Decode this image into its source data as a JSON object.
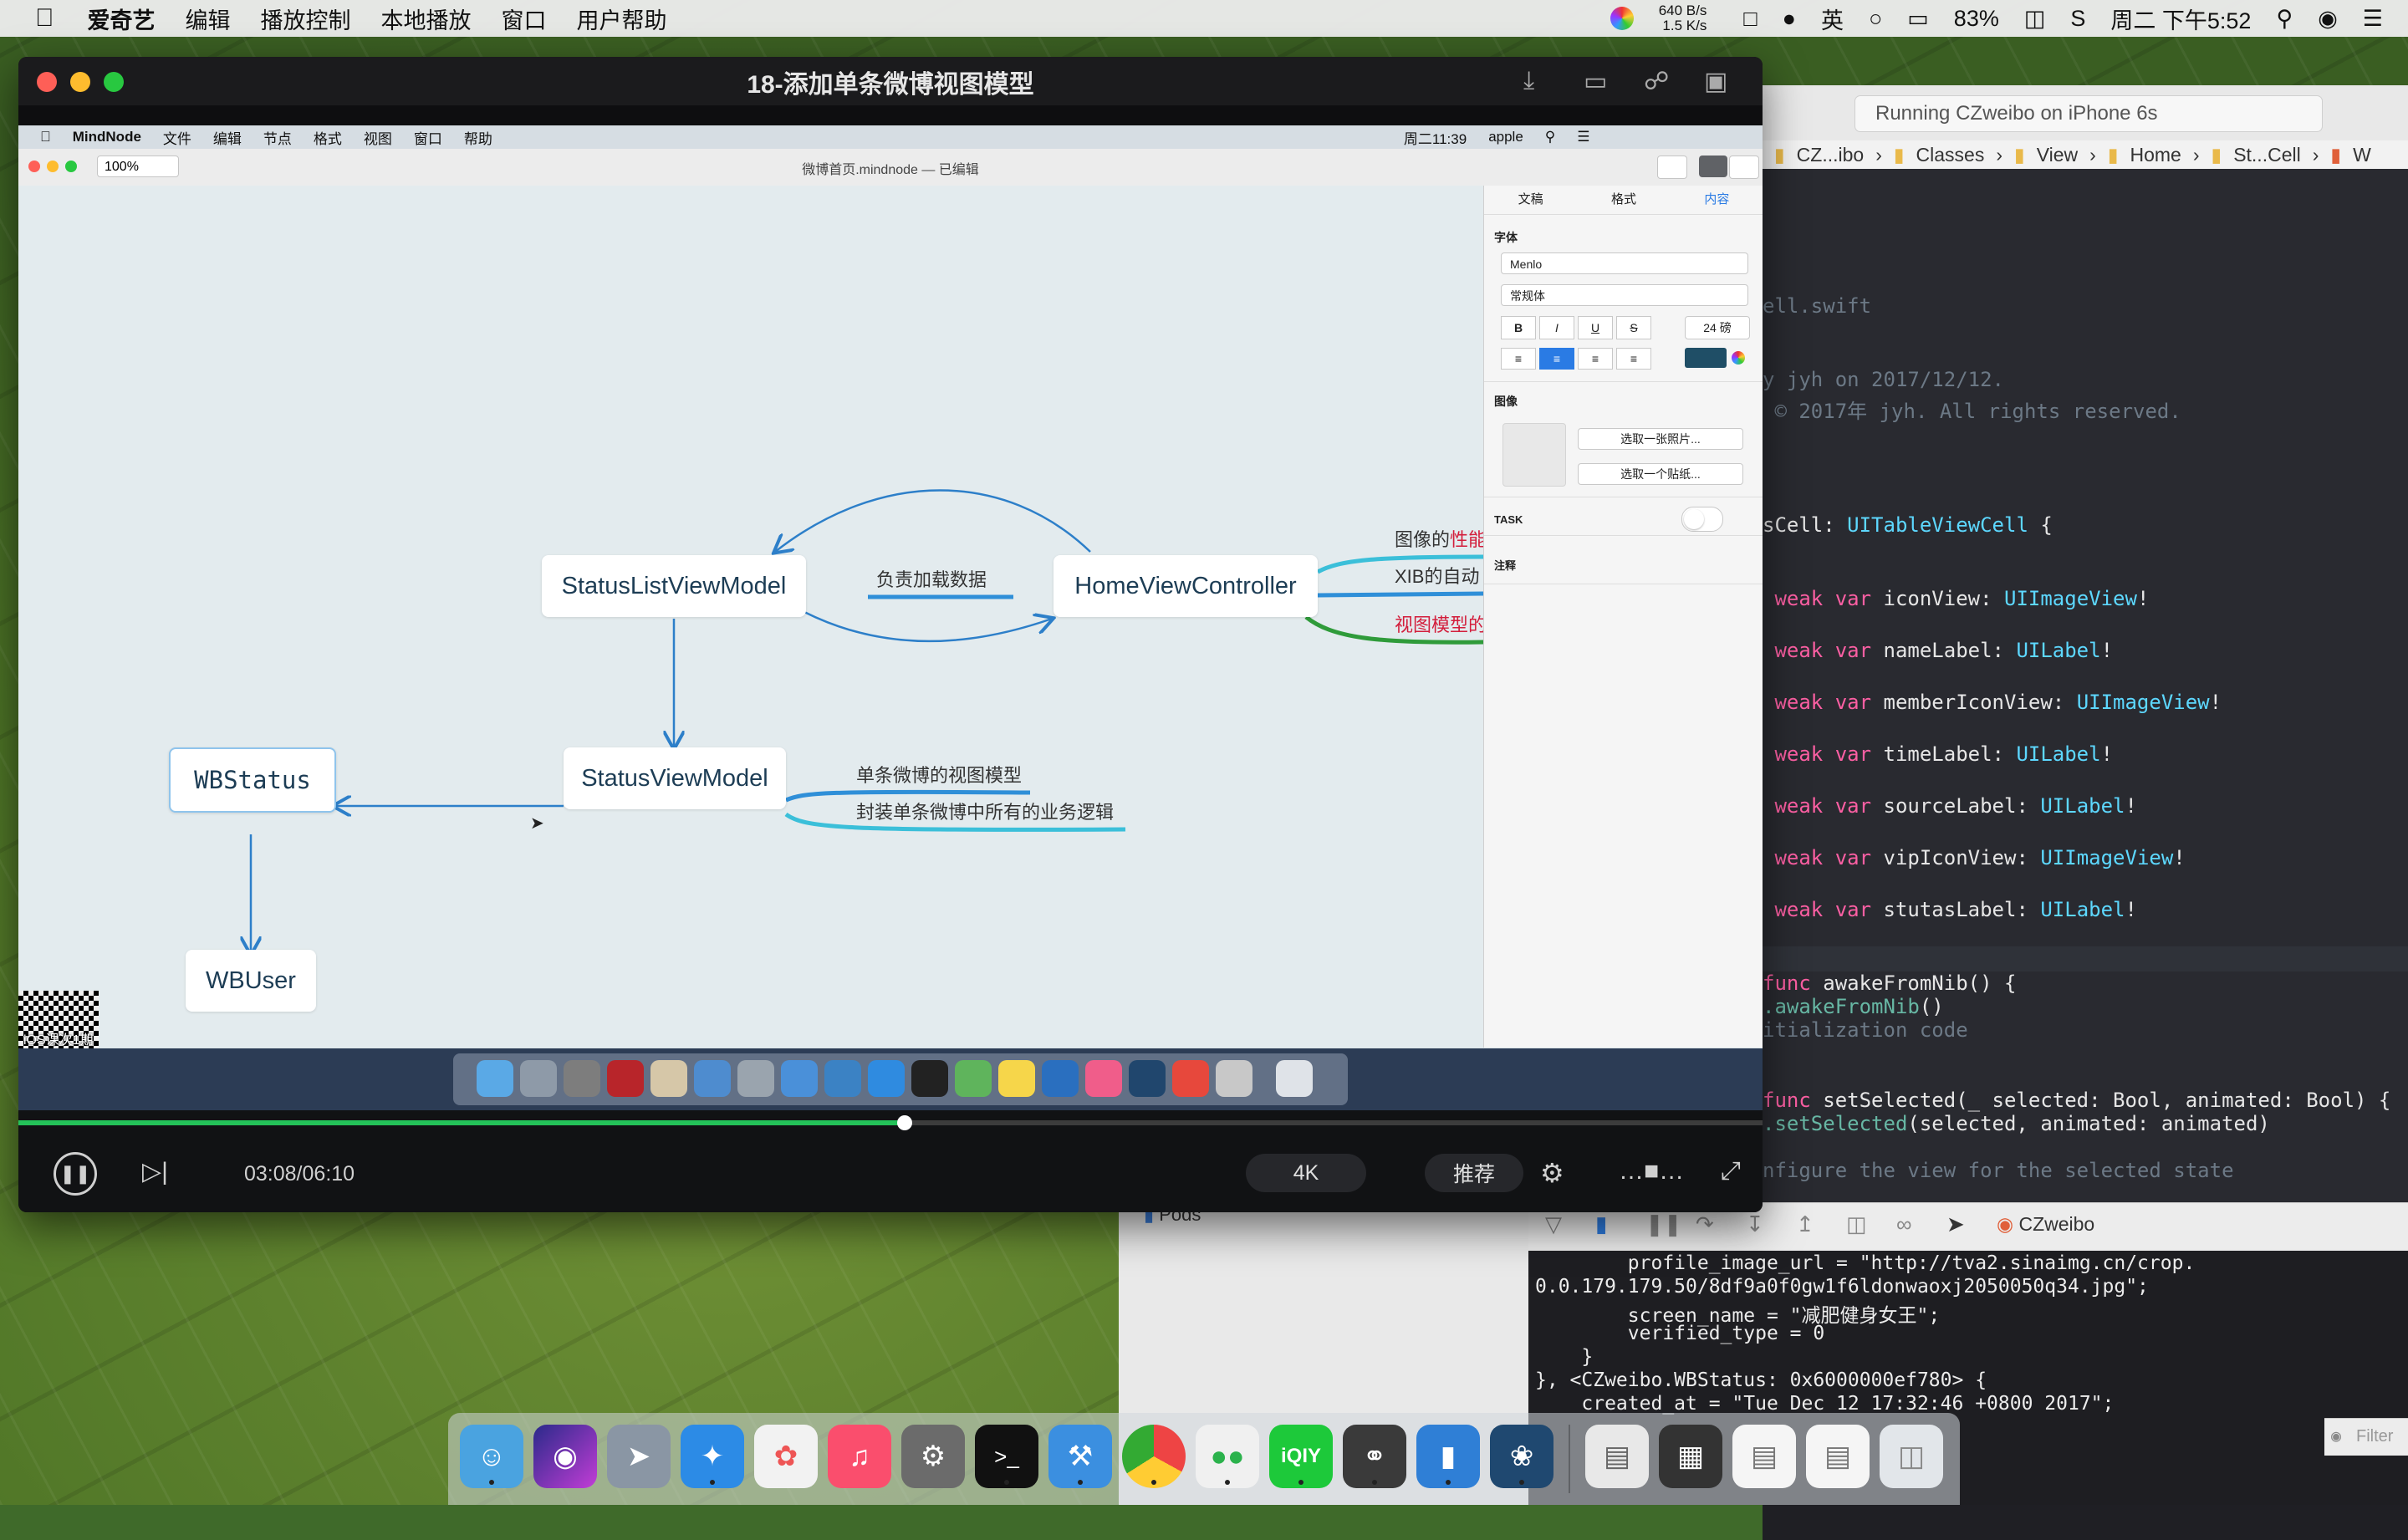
{
  "menubar": {
    "app_name": "爱奇艺",
    "items": [
      "编辑",
      "播放控制",
      "本地播放",
      "窗口",
      "用户帮助"
    ],
    "net_up": "640 B/s",
    "net_down": "1.5 K/s",
    "input_method": "英",
    "battery": "83%",
    "clock": "周二 下午5:52"
  },
  "player": {
    "title": "18-添加单条微博视图模型",
    "current_time": "03:08",
    "total_time": "06:10",
    "time_display": "03:08/06:10",
    "progress_percent": 50.8,
    "quality_label": "4K",
    "recommend_label": "推荐",
    "watermark": "iOS课次1期"
  },
  "video": {
    "mm_menubar": {
      "app": "MindNode",
      "items": [
        "文件",
        "编辑",
        "节点",
        "格式",
        "视图",
        "窗口",
        "帮助"
      ],
      "clock": "周二11:39",
      "user": "apple"
    },
    "doc_title": "微博首页.mindnode — 已编辑",
    "zoom": "100%",
    "inspector": {
      "tabs": [
        "文稿",
        "格式",
        "内容"
      ],
      "font_section": "字体",
      "font_name": "Menlo",
      "font_style": "常规体",
      "font_size": "24 磅",
      "image_section": "图像",
      "choose_photo": "选取一张照片...",
      "choose_sticker": "选取一个贴纸...",
      "task_label": "TASK",
      "notes_label": "注释"
    },
    "nodes": {
      "status_list_vm": "StatusListViewModel",
      "home_vc": "HomeViewController",
      "wbstatus": "WBStatus",
      "status_vm": "StatusViewModel",
      "wbuser": "WBUser"
    },
    "labels": {
      "load_data": "负责加载数据",
      "image_perf_a": "图像的",
      "image_perf_b": "性能",
      "xib_auto": "XIB的自动",
      "view_model": "视图模型的",
      "single_vm": "单条微博的视图模型",
      "business_logic": "封装单条微博中所有的业务逻辑"
    }
  },
  "xcode": {
    "run_status": "Running CZweibo on iPhone 6s",
    "jumpbar": [
      "CZ...ibo",
      "Classes",
      "View",
      "Home",
      "St...Cell",
      "W"
    ],
    "code_lines": [
      {
        "t": "ell.swift",
        "c": "cm"
      },
      {
        "t": "y jyh on 2017/12/12.",
        "c": "cm"
      },
      {
        "t": " © 2017年 jyh. All rights reserved.",
        "c": "cm"
      },
      {
        "t": "sCell: UITableViewCell {",
        "c": "plain"
      },
      {
        "t": " weak var iconView: UIImageView!",
        "c": "decl"
      },
      {
        "t": " weak var nameLabel: UILabel!",
        "c": "decl"
      },
      {
        "t": " weak var memberIconView: UIImageView!",
        "c": "decl"
      },
      {
        "t": " weak var timeLabel: UILabel!",
        "c": "decl"
      },
      {
        "t": " weak var sourceLabel: UILabel!",
        "c": "decl"
      },
      {
        "t": " weak var vipIconView: UIImageView!",
        "c": "decl"
      },
      {
        "t": " weak var stutasLabel: UILabel!",
        "c": "decl"
      },
      {
        "t": "func awakeFromNib() {",
        "c": "plain"
      },
      {
        "t": ".awakeFromNib()",
        "c": "plain"
      },
      {
        "t": "itialization code",
        "c": "cm"
      },
      {
        "t": "func setSelected(_ selected: Bool, animated: Bool) {",
        "c": "plain"
      },
      {
        "t": ".setSelected(selected, animated: animated)",
        "c": "plain"
      },
      {
        "t": "nfigure the view for the selected state",
        "c": "cm"
      }
    ],
    "debug_target": "CZweibo",
    "pods_label": "Pods",
    "console_lines": [
      "        profile_image_url = \"http://tva2.sinaimg.cn/crop.",
      "0.0.179.179.50/8df9a0f0gw1f6ldonwaoxj2050050q34.jpg\";",
      "        screen_name = \"减肥健身女王\";",
      "        verified_type = 0",
      "    }",
      "}, <CZweibo.WBStatus: 0x6000000ef780> {",
      "    created_at = \"Tue Dec 12 17:32:46 +0800 2017\";"
    ],
    "filter_placeholder": "Filter"
  },
  "dock_apps": [
    "finder-icon",
    "siri-icon",
    "launchpad-icon",
    "safari-icon",
    "photos-icon",
    "music-icon",
    "system-preferences-icon",
    "terminal-icon",
    "xcode-icon",
    "chrome-icon",
    "wechat-icon",
    "iqiyi-icon",
    "instruments-icon",
    "simulator-icon",
    "sourcetree-icon",
    "documents-icon",
    "trash-icon"
  ]
}
